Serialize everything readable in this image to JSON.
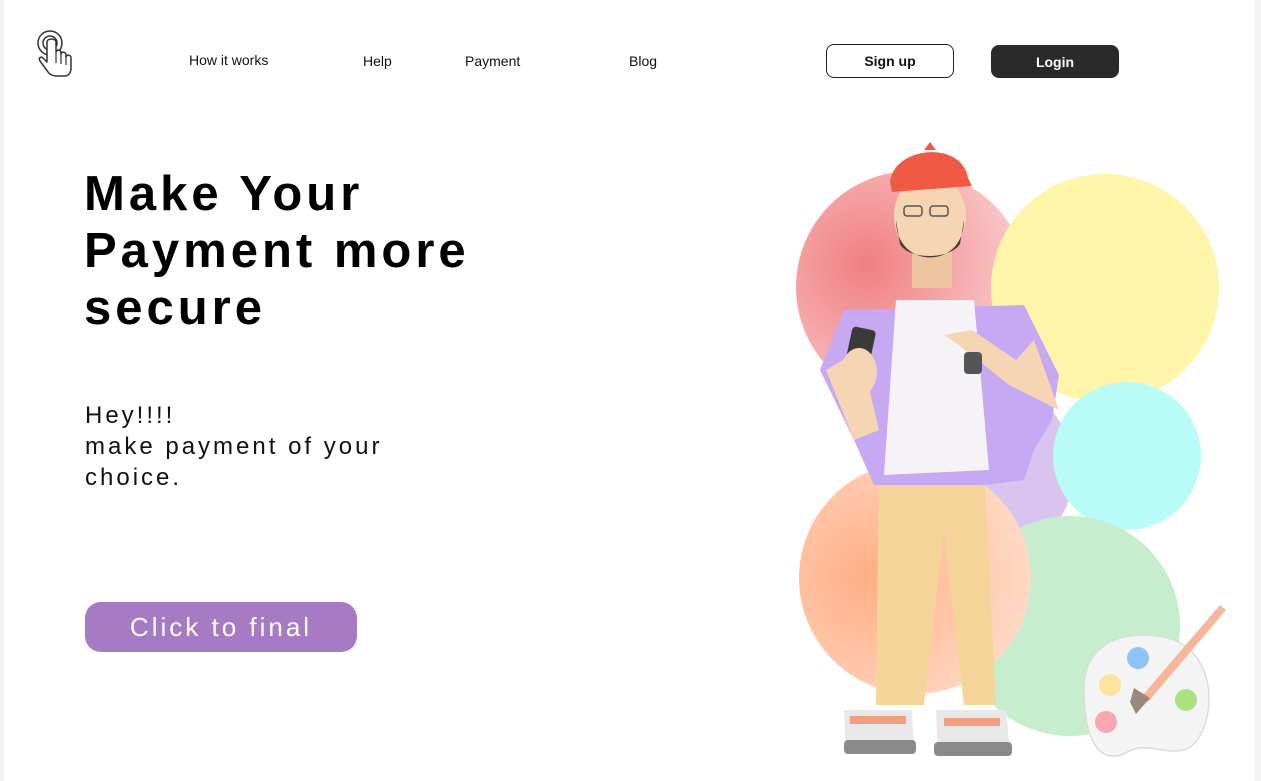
{
  "nav": {
    "logo_icon": "hand-pointer-icon",
    "links": [
      "How it works",
      "Help",
      "Payment",
      "Blog"
    ],
    "signup_label": "Sign up",
    "login_label": "Login"
  },
  "hero": {
    "title_lines": [
      "Make Your",
      "Payment more",
      "secure"
    ],
    "text_lines": [
      "Hey!!!!",
      "make payment of your",
      "choice."
    ],
    "cta_label": "Click to final"
  },
  "colors": {
    "accent": "#a77bc4",
    "dark_button": "#2a2a2a",
    "circle_red": "#f29a9a",
    "circle_yellow": "#fff5a8",
    "circle_purple": "#d9c4ef",
    "circle_cyan": "#b8fbf7",
    "circle_orange": "#ffc3a0",
    "circle_green": "#c6eece"
  },
  "illustration": {
    "subject_icon": "man-with-phone-illustration",
    "palette_icon": "paint-palette-icon"
  }
}
